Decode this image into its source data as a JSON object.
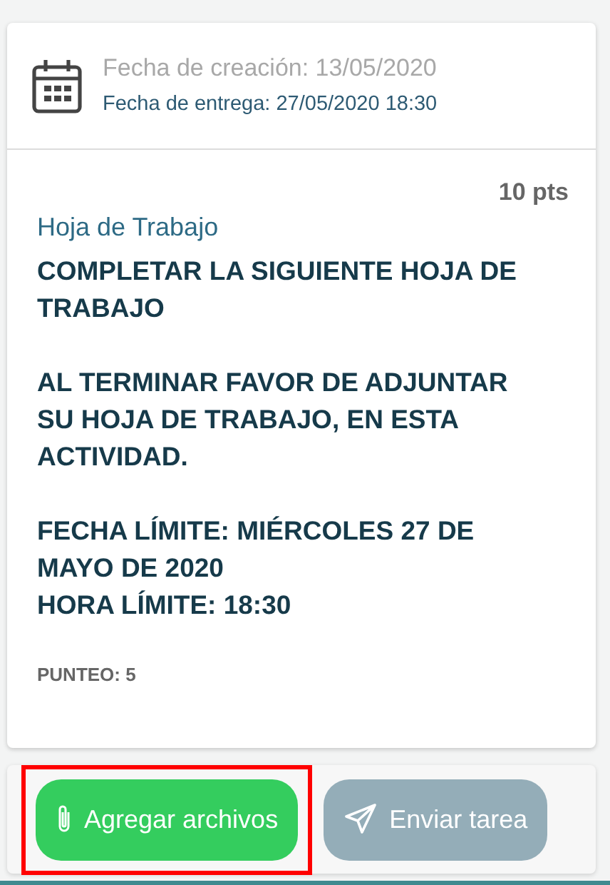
{
  "dates": {
    "created": "Fecha de creación: 13/05/2020",
    "due": "Fecha de entrega: 27/05/2020 18:30"
  },
  "points": "10 pts",
  "title": "Hoja de Trabajo",
  "paragraphs": [
    [
      "COMPLETAR LA SIGUIENTE HOJA DE TRABAJO"
    ],
    [
      "AL TERMINAR FAVOR DE ADJUNTAR SU HOJA DE TRABAJO, EN ESTA ACTIVIDAD."
    ],
    [
      "FECHA LÍMITE: MIÉRCOLES 27 DE MAYO DE 2020",
      "HORA LÍMITE: 18:30"
    ]
  ],
  "score": "PUNTEO: 5",
  "actions": [
    {
      "kind": "attach",
      "label": "Agregar archivos",
      "disabled": false,
      "highlighted": true
    },
    {
      "kind": "send",
      "label": "Enviar tarea",
      "disabled": true,
      "highlighted": false
    }
  ]
}
